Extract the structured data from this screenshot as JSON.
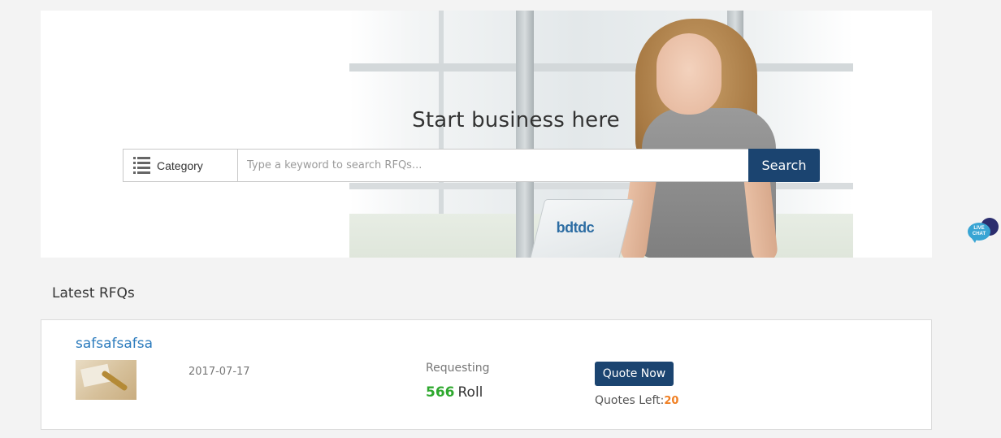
{
  "hero": {
    "title": "Start business here",
    "laptop_logo": "bdtdc",
    "search": {
      "category_label": "Category",
      "placeholder": "Type a keyword to search RFQs...",
      "value": "",
      "button_label": "Search"
    }
  },
  "live_chat": {
    "line1": "LIVE",
    "line2": "CHAT"
  },
  "latest_rfqs": {
    "section_title": "Latest RFQs",
    "items": [
      {
        "title": "safsafsafsa",
        "date": "2017-07-17",
        "requesting_label": "Requesting",
        "quantity": "566",
        "unit": "Roll",
        "quote_button_label": "Quote Now",
        "quotes_left_label": "Quotes Left:",
        "quotes_left_value": "20"
      }
    ]
  },
  "colors": {
    "primary_button": "#1b4470",
    "link": "#2b7bbd",
    "quantity_green": "#2ea82e",
    "quotes_left_orange": "#f07f22",
    "page_background": "#f3f3f3"
  }
}
